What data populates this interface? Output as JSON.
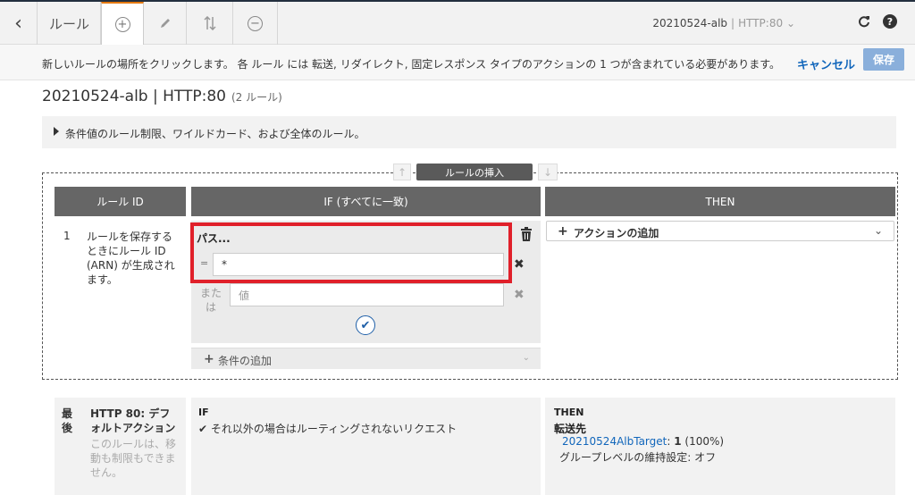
{
  "toolbar": {
    "back_glyph": "‹",
    "rules_label": "ルール",
    "listener_name": "20210524-alb",
    "listener_sep": "|",
    "listener_proto": "HTTP:80",
    "listener_chevron": "⌄"
  },
  "infobar": {
    "instruction": "新しいルールの場所をクリックします。 各 ルール には 転送, リダイレクト, 固定レスポンス タイプのアクションの 1 つが含まれている必要があります。",
    "cancel": "キャンセル",
    "save": "保存"
  },
  "page": {
    "title": "20210524-alb | HTTP:80",
    "rule_count": "(2 ルール)",
    "hint": "条件値のルール制限、ワイルドカード、および全体のルール。"
  },
  "insert": {
    "label": "ルールの挿入"
  },
  "columns": {
    "rule_id": "ルール ID",
    "if": "IF (すべてに一致)",
    "then": "THEN"
  },
  "new_rule": {
    "number": "1",
    "id_note": "ルールを保存するときにルール ID (ARN) が生成されます。",
    "condition_title": "パス...",
    "eq": "=",
    "value1": "*",
    "or_label": "または",
    "value2_placeholder": "値",
    "add_condition": "条件の追加",
    "add_action": "アクションの追加"
  },
  "default_rule": {
    "last": "最後",
    "name": "HTTP 80: デフォルトアクション",
    "note": "このルールは、移動も制限もできません。",
    "if_header": "IF",
    "if_text": "それ以外の場合はルーティングされないリクエスト",
    "then_header": "THEN",
    "forward": "転送先",
    "target_group": "20210524AlbTarget",
    "target_weight": "1",
    "target_pct": "(100%)",
    "sticky": "グループレベルの維持設定: オフ"
  },
  "colors": {
    "accent_orange": "#e47911",
    "link_blue": "#1166bb",
    "highlight_red": "#e0202a",
    "header_gray": "#666666"
  },
  "icons": [
    "back-icon",
    "add-rule-icon",
    "edit-icon",
    "reorder-icon",
    "delete-rule-icon",
    "refresh-icon",
    "help-icon",
    "trash-icon",
    "close-icon",
    "confirm-check-icon",
    "plus-icon",
    "chevron-down-icon",
    "expand-triangle-icon",
    "arrow-up-icon",
    "arrow-down-icon"
  ]
}
